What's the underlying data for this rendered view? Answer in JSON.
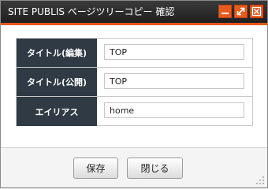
{
  "window": {
    "title": "SITE PUBLIS ページツリーコピー 確認",
    "accent_color": "#e4561b",
    "titlebar_color": "#262626",
    "controls": [
      {
        "name": "minimize-icon"
      },
      {
        "name": "maximize-icon"
      },
      {
        "name": "close-icon"
      }
    ]
  },
  "form": {
    "rows": [
      {
        "label": "タイトル(編集)",
        "value": "TOP"
      },
      {
        "label": "タイトル(公開)",
        "value": "TOP"
      },
      {
        "label": "エイリアス",
        "value": "home"
      }
    ],
    "label_bg_color": "#2f3a44"
  },
  "footer": {
    "save_label": "保存",
    "close_label": "閉じる"
  }
}
